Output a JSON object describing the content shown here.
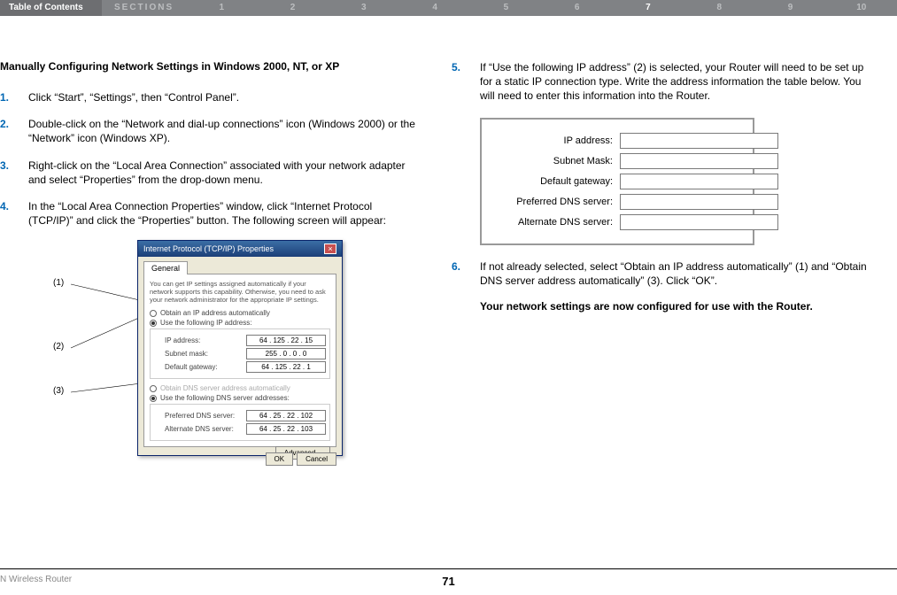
{
  "nav": {
    "toc": "Table of Contents",
    "sections": "SECTIONS",
    "nums": [
      "1",
      "2",
      "3",
      "4",
      "5",
      "6",
      "7",
      "8",
      "9",
      "10"
    ],
    "active": "7"
  },
  "heading": "Manually Configuring Network Settings in Windows 2000, NT, or XP",
  "steps_left": [
    {
      "num": "1.",
      "text": "Click “Start”, “Settings”, then “Control Panel”."
    },
    {
      "num": "2.",
      "text": "Double-click on the “Network and dial-up connections” icon (Windows 2000) or the “Network” icon (Windows XP)."
    },
    {
      "num": "3.",
      "text": "Right-click on the “Local Area Connection” associated with your network adapter and select “Properties” from the drop-down menu."
    },
    {
      "num": "4.",
      "text": "In the “Local Area Connection Properties” window, click “Internet Protocol (TCP/IP)” and click the “Properties” button. The following screen will appear:"
    }
  ],
  "callouts": {
    "c1": "(1)",
    "c2": "(2)",
    "c3": "(3)"
  },
  "dialog": {
    "title": "Internet Protocol (TCP/IP) Properties",
    "tab": "General",
    "desc": "You can get IP settings assigned automatically if your network supports this capability. Otherwise, you need to ask your network administrator for the appropriate IP settings.",
    "radio_auto": "Obtain an IP address automatically",
    "radio_use": "Use the following IP address:",
    "ip_label": "IP address:",
    "ip_val": "64 . 125 . 22 . 15",
    "sm_label": "Subnet mask:",
    "sm_val": "255 . 0 . 0 . 0",
    "gw_label": "Default gateway:",
    "gw_val": "64 . 125 . 22 . 1",
    "radio_dns_auto": "Obtain DNS server address automatically",
    "radio_dns_use": "Use the following DNS server addresses:",
    "pdns_label": "Preferred DNS server:",
    "pdns_val": "64 . 25 . 22 . 102",
    "adns_label": "Alternate DNS server:",
    "adns_val": "64 . 25 . 22 . 103",
    "advanced": "Advanced...",
    "ok": "OK",
    "cancel": "Cancel"
  },
  "steps_right": [
    {
      "num": "5.",
      "text": "If “Use the following IP address” (2) is selected, your Router will need to be set up for a static IP connection type. Write the address information the table below. You will need to enter this information into the Router."
    },
    {
      "num": "6.",
      "text": "If not already selected, select “Obtain an IP address automatically” (1) and “Obtain DNS server address automatically” (3). Click “OK”."
    }
  ],
  "ip_table": {
    "ip": "IP address:",
    "sm": "Subnet Mask:",
    "gw": "Default gateway:",
    "pdns": "Preferred DNS server:",
    "adns": "Alternate DNS server:"
  },
  "final": "Your network settings are now configured for use with the Router.",
  "footer": {
    "left": "N Wireless Router",
    "page": "71"
  }
}
